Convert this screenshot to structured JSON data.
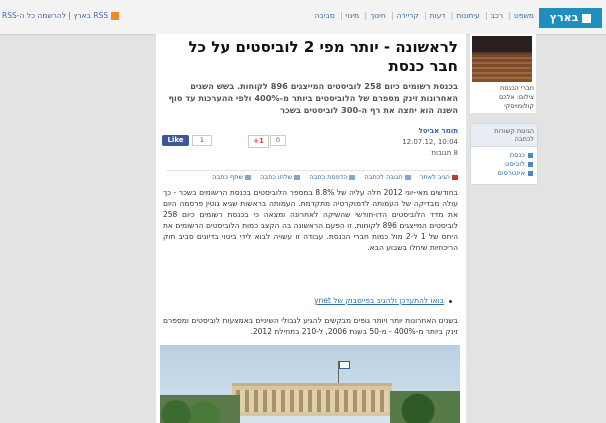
{
  "topbar": {
    "rss_links": "RSS בארץ | להרשמה כל ה-RSS",
    "logo": "בארץ",
    "nav": [
      "משפט",
      "רכב",
      "עיתונות",
      "דעות",
      "קריירה",
      "חינוך",
      "מינוי",
      "סביבה"
    ]
  },
  "article": {
    "title": "לראשונה - יותר מפי 2 לוביסטים על כל חבר כנסת",
    "lead": "בכנסת רשומים כיום 258 לוביסטים המייצגים 896 לקוחות. בשש השנים האחרונות זינק מספרם של הלוביסטים ביותר מ-400% ולפי ההערכות עד סוף השנה הוא יחצה את רף ה-300 לוביסטים בשכר",
    "author": "תומר אביטל",
    "date": "10:04 ,12.07.12",
    "comments": "8 תגובות",
    "fb_label": "Like",
    "fb_count": "1",
    "gp_label": "+1",
    "gp_count": "0",
    "tools": [
      "הגיב לאתר",
      "תגובה לכתבה",
      "הדפסת כתבה",
      "שלחו כתבה",
      "שתף כתבה"
    ],
    "body1": "בחודשים מאי-יוני 2012 חלה עליה של 8.8% במספר הלוביסטים בכנסת הרשומים בשכר - כך עולה מבדיקה של העמותה לדמוקרטיה מתקדמת. העמותה בראשות שגיא גוטין פרסמה היום את מדד הלוביסטים הדו-חודשי שהשיקה לאחרונה ומצאה כי בכנסת רשומים כיום 258 לוביסטים המייצגים 896 לקוחות. זו הפעם הראשונה בה הקצב כמות הלוביסטים הרשומים את היחס של 1 ל-2 מול כמות חברי הכנסת. עבודה זו עשויה לבוא לידי ביטוי בדיונים סביב חוק הריכוזיות שיחלו בשבוע הבא.",
    "bullet_link": "בואו להתעדכן ולהגיב בפייסבוק של ynet",
    "body2": "בשנים האחרונות יותר ויותר גופים מבקשים להגיע לגבולי השיניים באמצעות לוביסטים ומספרם זינק ביותר מ-400% - מ-50 בשנת 2006, ל-210 בתחילת 2012."
  },
  "sidebar": {
    "photo_caption_1": "חברי הכנסת",
    "photo_caption_2": "צילום: אלכס קולומויסקי",
    "related_header": "הגיגות קשורות לכתבה",
    "related_items": [
      "כנסת",
      "לוביסט",
      "אינטרסים"
    ]
  }
}
